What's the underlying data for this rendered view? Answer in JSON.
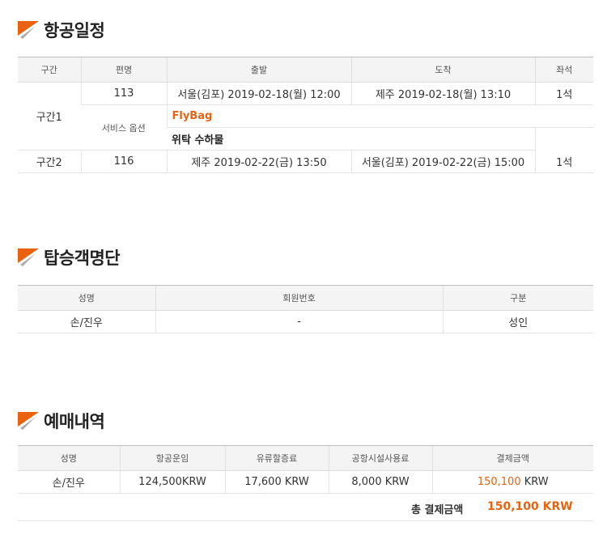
{
  "colors": {
    "accent": "#e8620f",
    "header_bg": "#f4f4f4"
  },
  "itinerary": {
    "title": "항공일정",
    "headers": [
      "구간",
      "편명",
      "출발",
      "도착",
      "좌석"
    ],
    "segment1": {
      "label": "구간1",
      "flight": "113",
      "departure": "서울(김포) 2019-02-18(월) 12:00",
      "arrival": "제주 2019-02-18(월) 13:10",
      "seats": "1석",
      "service_label": "서비스 옵션",
      "service1": "FlyBag",
      "service2": "위탁 수하물"
    },
    "segment2": {
      "label": "구간2",
      "flight": "116",
      "departure": "제주 2019-02-22(금) 13:50",
      "arrival": "서울(김포) 2019-02-22(금) 15:00",
      "seats": "1석"
    }
  },
  "passengers": {
    "title": "탑승객명단",
    "headers": [
      "성명",
      "회원번호",
      "구분"
    ],
    "rows": [
      {
        "name": "손/진우",
        "member_no": "-",
        "type": "성인"
      }
    ]
  },
  "booking": {
    "title": "예매내역",
    "headers": [
      "성명",
      "항공운임",
      "유류할증료",
      "공항시설사용료",
      "결제금액"
    ],
    "rows": [
      {
        "name": "손/진우",
        "fare": "124,500KRW",
        "fuel": "17,600 KRW",
        "airport": "8,000 KRW",
        "payment_num": "150,100",
        "payment_unit": " KRW"
      }
    ],
    "total_label": "총 결제금액",
    "total_value": "150,100 KRW"
  }
}
